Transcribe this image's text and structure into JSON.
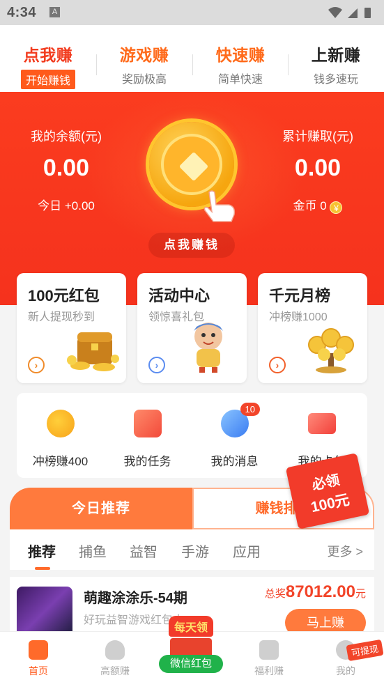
{
  "status_bar": {
    "time": "4:34",
    "notification_letter": "A"
  },
  "top_tabs": [
    {
      "title": "点我赚",
      "subtitle": "开始赚钱"
    },
    {
      "title": "游戏赚",
      "subtitle": "奖励极高"
    },
    {
      "title": "快速赚",
      "subtitle": "简单快速"
    },
    {
      "title": "上新赚",
      "subtitle": "钱多速玩"
    }
  ],
  "hero": {
    "balance_label": "我的余额(元)",
    "balance_value": "0.00",
    "today_text": "今日 +0.00",
    "earned_label": "累计赚取(元)",
    "earned_value": "0.00",
    "coins_text": "金币 0",
    "coin_symbol": "¥",
    "click_button": "点我赚钱"
  },
  "feature_cards": [
    {
      "title": "100元红包",
      "subtitle": "新人提现秒到",
      "icon": "treasure-chest-icon"
    },
    {
      "title": "活动中心",
      "subtitle": "领惊喜礼包",
      "icon": "mascot-icon"
    },
    {
      "title": "千元月榜",
      "subtitle": "冲榜赚1000",
      "icon": "money-tree-icon"
    }
  ],
  "quick_actions": [
    {
      "label": "冲榜赚400",
      "icon": "yuan-coin-icon"
    },
    {
      "label": "我的任务",
      "icon": "calendar-icon"
    },
    {
      "label": "我的消息",
      "icon": "message-icon",
      "badge": "10"
    },
    {
      "label": "我的卡包",
      "icon": "ticket-icon"
    }
  ],
  "reward_badge": {
    "line1": "必领",
    "line2": "100元"
  },
  "recommend_tabs": {
    "left": "今日推荐",
    "right": "赚钱排行"
  },
  "categories": [
    "推荐",
    "捕鱼",
    "益智",
    "手游",
    "应用"
  ],
  "more_label": "更多 >",
  "game": {
    "title": "萌趣涂涂乐-54期",
    "desc": "好玩益智游戏红包大",
    "prize_prefix": "总奖",
    "prize_value": "87012.00",
    "prize_unit": "元",
    "play_button": "马上赚"
  },
  "bottom_nav": [
    {
      "label": "首页"
    },
    {
      "label": "高额赚"
    },
    {
      "label": "福利赚"
    },
    {
      "label": "我的"
    }
  ],
  "wechat_promo": {
    "top": "每天领",
    "label": "微信红包"
  },
  "withdraw_tag": "可提现"
}
